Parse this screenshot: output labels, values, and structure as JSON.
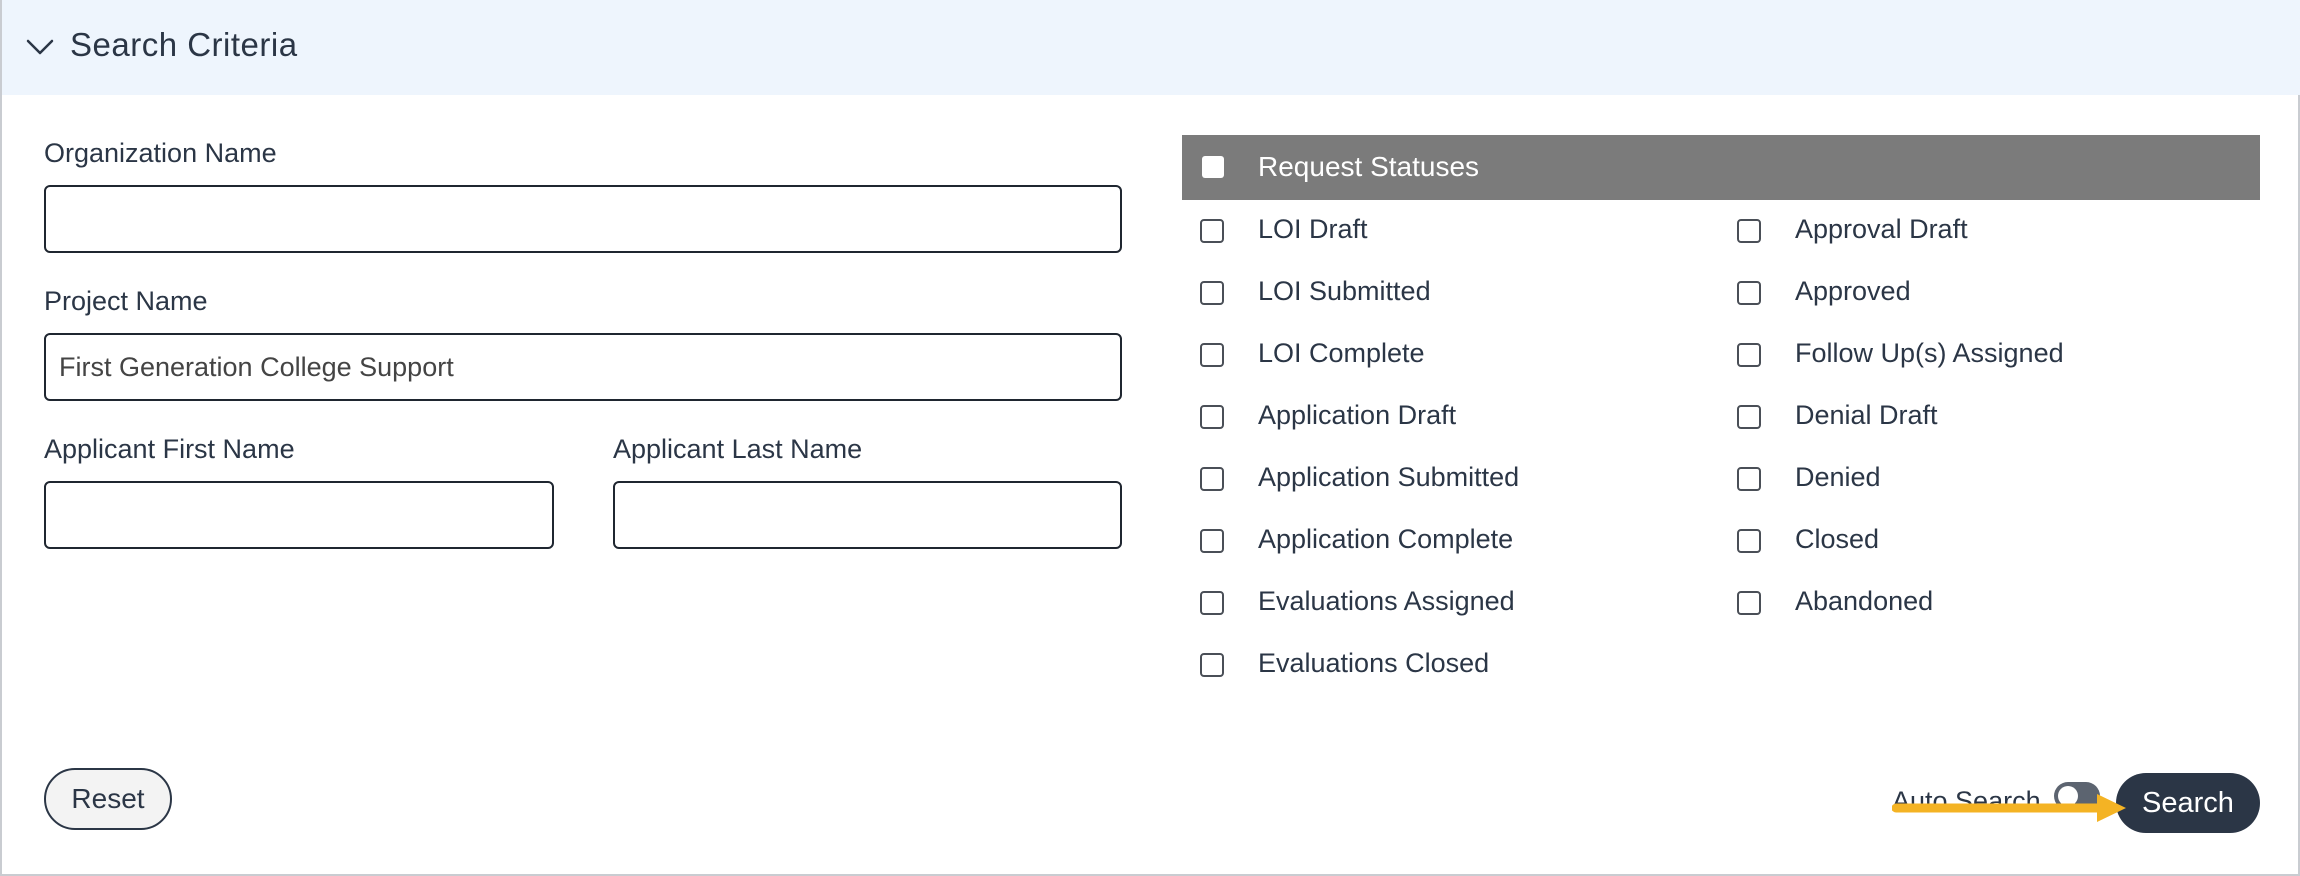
{
  "header": {
    "title": "Search Criteria",
    "icon": "chevron-down-icon"
  },
  "fields": {
    "org_name": {
      "label": "Organization Name",
      "value": ""
    },
    "project_name": {
      "label": "Project Name",
      "value": "First Generation College Support"
    },
    "first_name": {
      "label": "Applicant First Name",
      "value": ""
    },
    "last_name": {
      "label": "Applicant Last Name",
      "value": ""
    }
  },
  "statuses": {
    "title": "Request Statuses",
    "left": [
      "LOI Draft",
      "LOI Submitted",
      "LOI Complete",
      "Application Draft",
      "Application Submitted",
      "Application Complete",
      "Evaluations Assigned",
      "Evaluations Closed"
    ],
    "right": [
      "Approval Draft",
      "Approved",
      "Follow Up(s) Assigned",
      "Denial Draft",
      "Denied",
      "Closed",
      "Abandoned"
    ]
  },
  "footer": {
    "reset_label": "Reset",
    "auto_search_label": "Auto Search",
    "search_label": "Search"
  },
  "colors": {
    "header_bg": "#eef5fd",
    "status_header_bg": "#7b7b7b",
    "primary_btn": "#2b3646",
    "annotation_arrow": "#f4b324"
  }
}
